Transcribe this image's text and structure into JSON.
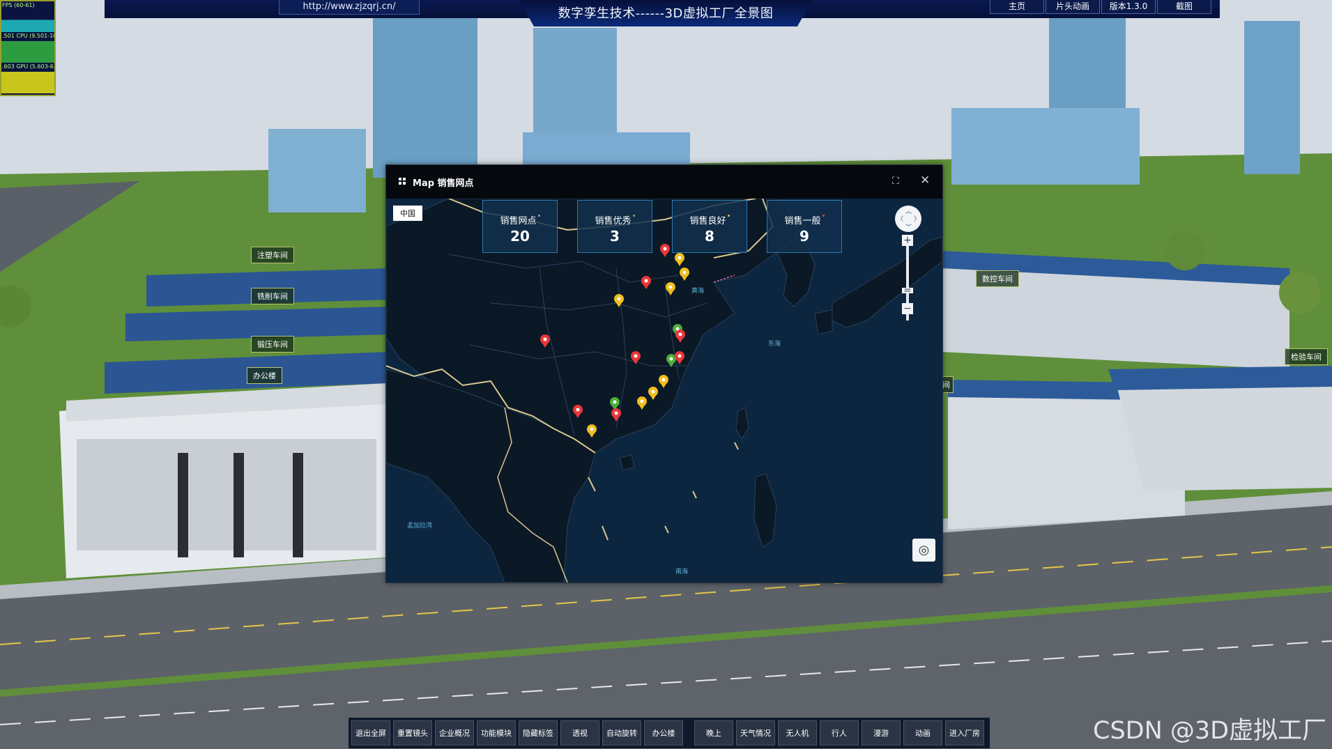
{
  "header": {
    "url": "http://www.zjzqrj.cn/",
    "title": "数字孪生技术------3D虚拟工厂全景图",
    "nav": [
      "主页",
      "片头动画",
      "版本1.3.0",
      "截图"
    ]
  },
  "perf_monitor": {
    "fps": "FPS (60-61)",
    "cpu": ".501 CPU (9.501-10",
    "gpu": ".603 GPU (5.603-6.0"
  },
  "building_labels": [
    "注塑车间",
    "铣削车间",
    "锻压车间",
    "办公楼",
    "数控车间",
    "检验车间",
    "间"
  ],
  "map_dialog": {
    "title": "Map 销售网点",
    "region": "中国",
    "stats": [
      {
        "label": "销售网点",
        "value": "20",
        "dot_color": "#b57cff"
      },
      {
        "label": "销售优秀",
        "value": "3",
        "dot_color": "#4ad04a"
      },
      {
        "label": "销售良好",
        "value": "8",
        "dot_color": "#f0c020"
      },
      {
        "label": "销售一般",
        "value": "9",
        "dot_color": "#ff4040"
      }
    ],
    "sea_labels": [
      "黄海",
      "东海",
      "南海",
      "孟加拉湾"
    ],
    "marker_colors": {
      "excellent": "#4caf3a",
      "good": "#f2be1e",
      "normal": "#e8383a"
    }
  },
  "toolbar": {
    "buttons": [
      "退出全屏",
      "重置镜头",
      "企业概况",
      "功能模块",
      "隐藏标签",
      "透视",
      "自动旋转",
      "办公楼",
      "晚上",
      "天气情况",
      "无人机",
      "行人",
      "漫游",
      "动画",
      "进入厂房"
    ]
  },
  "watermark": "CSDN @3D虚拟工厂"
}
